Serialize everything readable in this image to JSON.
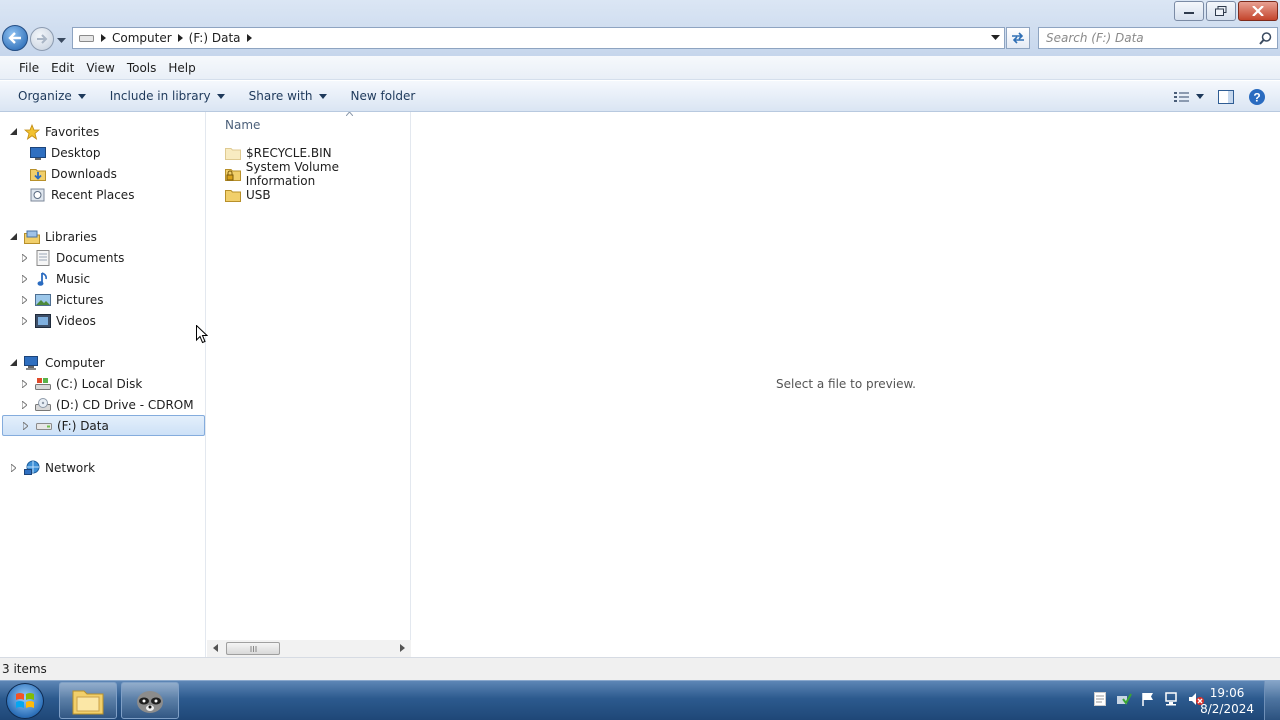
{
  "window": {
    "controls": {
      "minimize": "minimize",
      "maximize": "maximize",
      "close": "close"
    }
  },
  "address": {
    "crumbs": [
      "Computer",
      "(F:) Data"
    ]
  },
  "search": {
    "placeholder": "Search (F:) Data"
  },
  "menu": [
    "File",
    "Edit",
    "View",
    "Tools",
    "Help"
  ],
  "commands": {
    "organize": "Organize",
    "include": "Include in library",
    "share": "Share with",
    "new_folder": "New folder"
  },
  "nav": {
    "favorites": "Favorites",
    "desktop": "Desktop",
    "downloads": "Downloads",
    "recent_places": "Recent Places",
    "libraries": "Libraries",
    "documents": "Documents",
    "music": "Music",
    "pictures": "Pictures",
    "videos": "Videos",
    "computer": "Computer",
    "local_disk": "(C:) Local Disk",
    "cd_drive": "(D:) CD Drive - CDROM",
    "data_drive": "(F:) Data",
    "network": "Network"
  },
  "files": {
    "column": "Name",
    "items": [
      "$RECYCLE.BIN",
      "System Volume Information",
      "USB"
    ]
  },
  "preview": {
    "message": "Select a file to preview."
  },
  "status": {
    "count": "3 items"
  },
  "taskbar": {
    "time": "19:06",
    "date": "8/2/2024"
  },
  "colors": {
    "selection": "#cde1f7",
    "selection_border": "#84acdd",
    "taskbar": "#2c5a8e",
    "folder": "#f1cf6b"
  }
}
